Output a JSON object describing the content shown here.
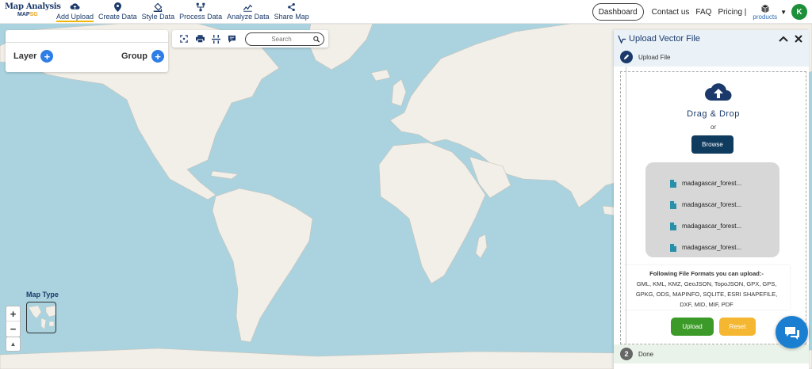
{
  "brand": {
    "title": "Map Analysis",
    "sub_a": "MAP",
    "sub_b": "SG"
  },
  "nav": [
    {
      "label": "Add Upload"
    },
    {
      "label": "Create Data"
    },
    {
      "label": "Style Data"
    },
    {
      "label": "Process Data"
    },
    {
      "label": "Analyze Data"
    },
    {
      "label": "Share Map"
    }
  ],
  "right_nav": {
    "dashboard": "Dashboard",
    "contact": "Contact us",
    "faq": "FAQ",
    "pricing": "Pricing |",
    "products": "products",
    "avatar": "K"
  },
  "layer_panel": {
    "layer": "Layer",
    "group": "Group"
  },
  "search": {
    "placeholder": "Search"
  },
  "map_type": {
    "label": "Map Type"
  },
  "zoom": {
    "in": "+",
    "out": "−"
  },
  "upload_panel": {
    "title": "Upload Vector File",
    "step1": "Upload File",
    "drag_drop": "Drag & Drop",
    "or": "or",
    "browse": "Browse",
    "files": [
      "madagascar_forest...",
      "madagascar_forest...",
      "madagascar_forest...",
      "madagascar_forest..."
    ],
    "formats_heading": "Following File Formats you can upload:-",
    "formats_list": "GML, KML, KMZ, GeoJSON, TopoJSON, GPX, GPS, GPKG, ODS, MAPINFO, SQLITE, ESRI SHAPEFILE, DXF, MID, MIF, PDF",
    "upload": "Upload",
    "reset": "Reset",
    "step2_num": "2",
    "step2": "Done"
  },
  "colors": {
    "brand": "#1b3a6b",
    "accent": "#f2b705",
    "upload": "#3b9a28",
    "reset": "#f5b731",
    "browse": "#0f3b5f",
    "ocean": "#aad3df"
  }
}
